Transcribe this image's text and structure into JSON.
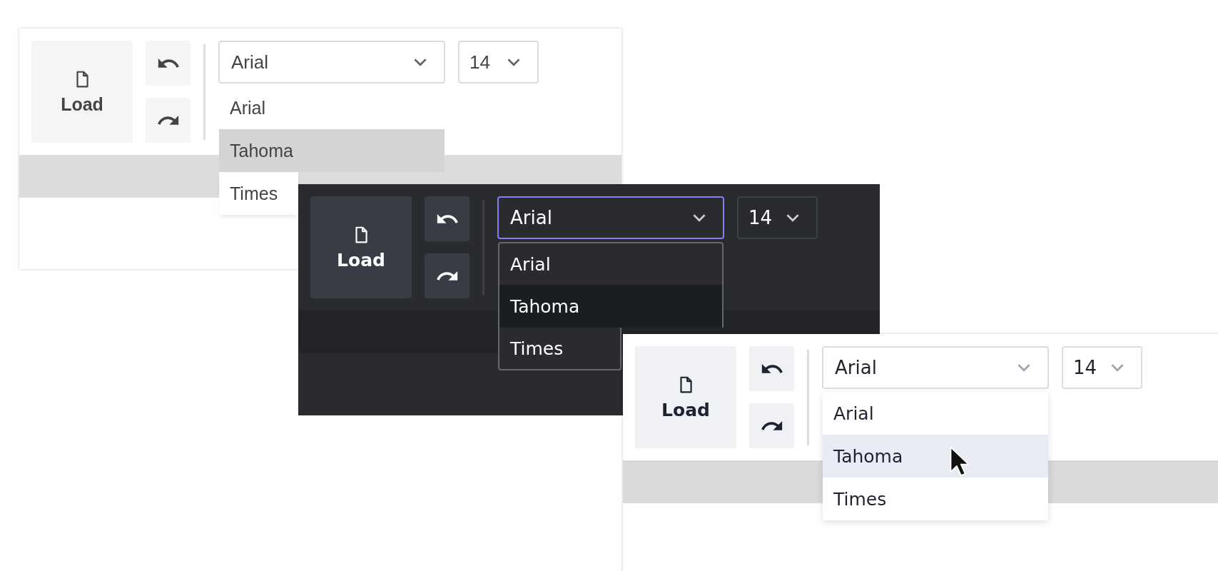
{
  "panels": [
    {
      "kind": "gray",
      "focused": false,
      "load_label": "Load",
      "font_value": "Arial",
      "size_value": "14",
      "options": [
        {
          "label": "Arial",
          "selected": false
        },
        {
          "label": "Tahoma",
          "selected": true
        },
        {
          "label": "Times",
          "selected": false
        }
      ]
    },
    {
      "kind": "dark",
      "focused": true,
      "load_label": "Load",
      "font_value": "Arial",
      "size_value": "14",
      "options": [
        {
          "label": "Arial",
          "selected": false
        },
        {
          "label": "Tahoma",
          "selected": true
        },
        {
          "label": "Times",
          "selected": false
        }
      ]
    },
    {
      "kind": "light",
      "focused": false,
      "load_label": "Load",
      "font_value": "Arial",
      "size_value": "14",
      "options": [
        {
          "label": "Arial",
          "selected": false
        },
        {
          "label": "Tahoma",
          "selected": true
        },
        {
          "label": "Times",
          "selected": false
        }
      ]
    }
  ]
}
